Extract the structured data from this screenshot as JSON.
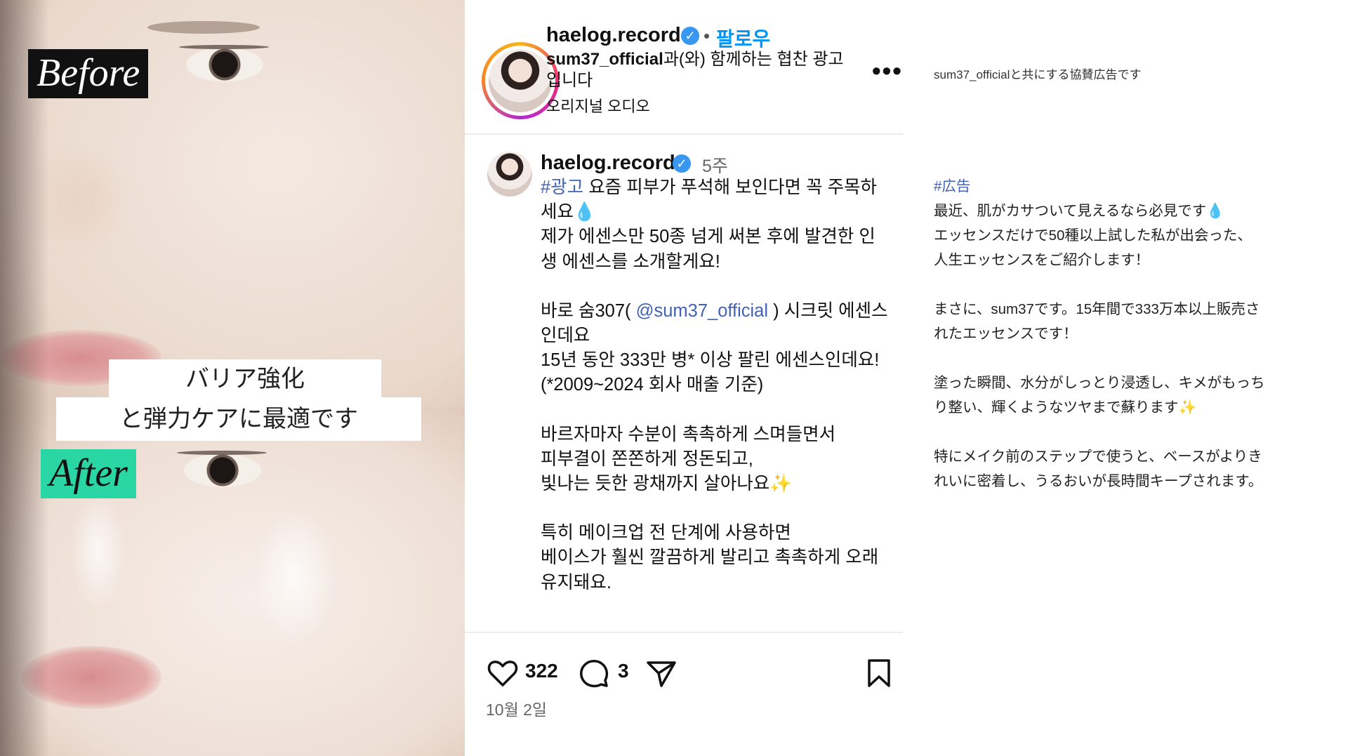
{
  "photo": {
    "before_label": "Before",
    "after_label": "After",
    "caption_line1": "バリア強化",
    "caption_line2": "と弾力ケアに最適です"
  },
  "post": {
    "header": {
      "username": "haelog.record",
      "separator": "•",
      "follow_label": "팔로우",
      "sponsor_account": "sum37_official",
      "sponsor_text": "과(와) 함께하는 협찬 광고입니다",
      "audio": "오리지널 오디오",
      "more_label": "•••"
    },
    "caption": {
      "username": "haelog.record",
      "age": "5주",
      "hashtag": "#광고",
      "line1_rest": " 요즘 피부가 푸석해 보인다면 꼭 주목하세요💧",
      "line2": "제가 에센스만 50종 넘게 써본 후에 발견한 인생 에센스를 소개할게요!",
      "line3_pre": "바로 숨307( ",
      "mention": "@sum37_official",
      "line3_post": " ) 시크릿 에센스인데요",
      "line4": "15년 동안 333만 병* 이상 팔린 에센스인데요!",
      "line5": "(*2009~2024 회사 매출 기준)",
      "line6": "바르자마자 수분이 촉촉하게 스며들면서",
      "line7": "피부결이 쫀쫀하게 정돈되고,",
      "line8": "빛나는 듯한 광채까지 살아나요✨",
      "line9": "특히 메이크업 전 단계에 사용하면",
      "line10": "베이스가 훨씬 깔끔하게 발리고 촉촉하게 오래 유지돼요."
    },
    "footer": {
      "likes": "322",
      "comments": "3",
      "date": "10월 2일"
    }
  },
  "translation": {
    "sponsor": "sum37_officialと共にする協賛広告です",
    "hashtag": "#広告",
    "p1_l1": " 最近、肌がカサついて見えるなら必見です💧",
    "p1_l2": " エッセンスだけで50種以上試した私が出会った、",
    "p1_l3": "人生エッセンスをご紹介します！",
    "p2_l1": "まさに、sum37です。15年間で333万本以上販売さ",
    "p2_l2": "れたエッセンスです！",
    "p3_l1": "塗った瞬間、水分がしっとり浸透し、キメがもっち",
    "p3_l2": "り整い、輝くようなツヤまで蘇ります✨",
    "p4_l1": "特にメイク前のステップで使うと、ベースがよりき",
    "p4_l2": "れいに密着し、うるおいが長時間キープされます。"
  },
  "colors": {
    "link": "#4162b7",
    "follow": "#0095f6",
    "verified": "#3897f0",
    "after_tag": "#2bd6a5"
  },
  "icons": [
    "verified-badge-icon",
    "more-options-icon",
    "heart-icon",
    "comment-icon",
    "share-icon",
    "bookmark-icon"
  ]
}
